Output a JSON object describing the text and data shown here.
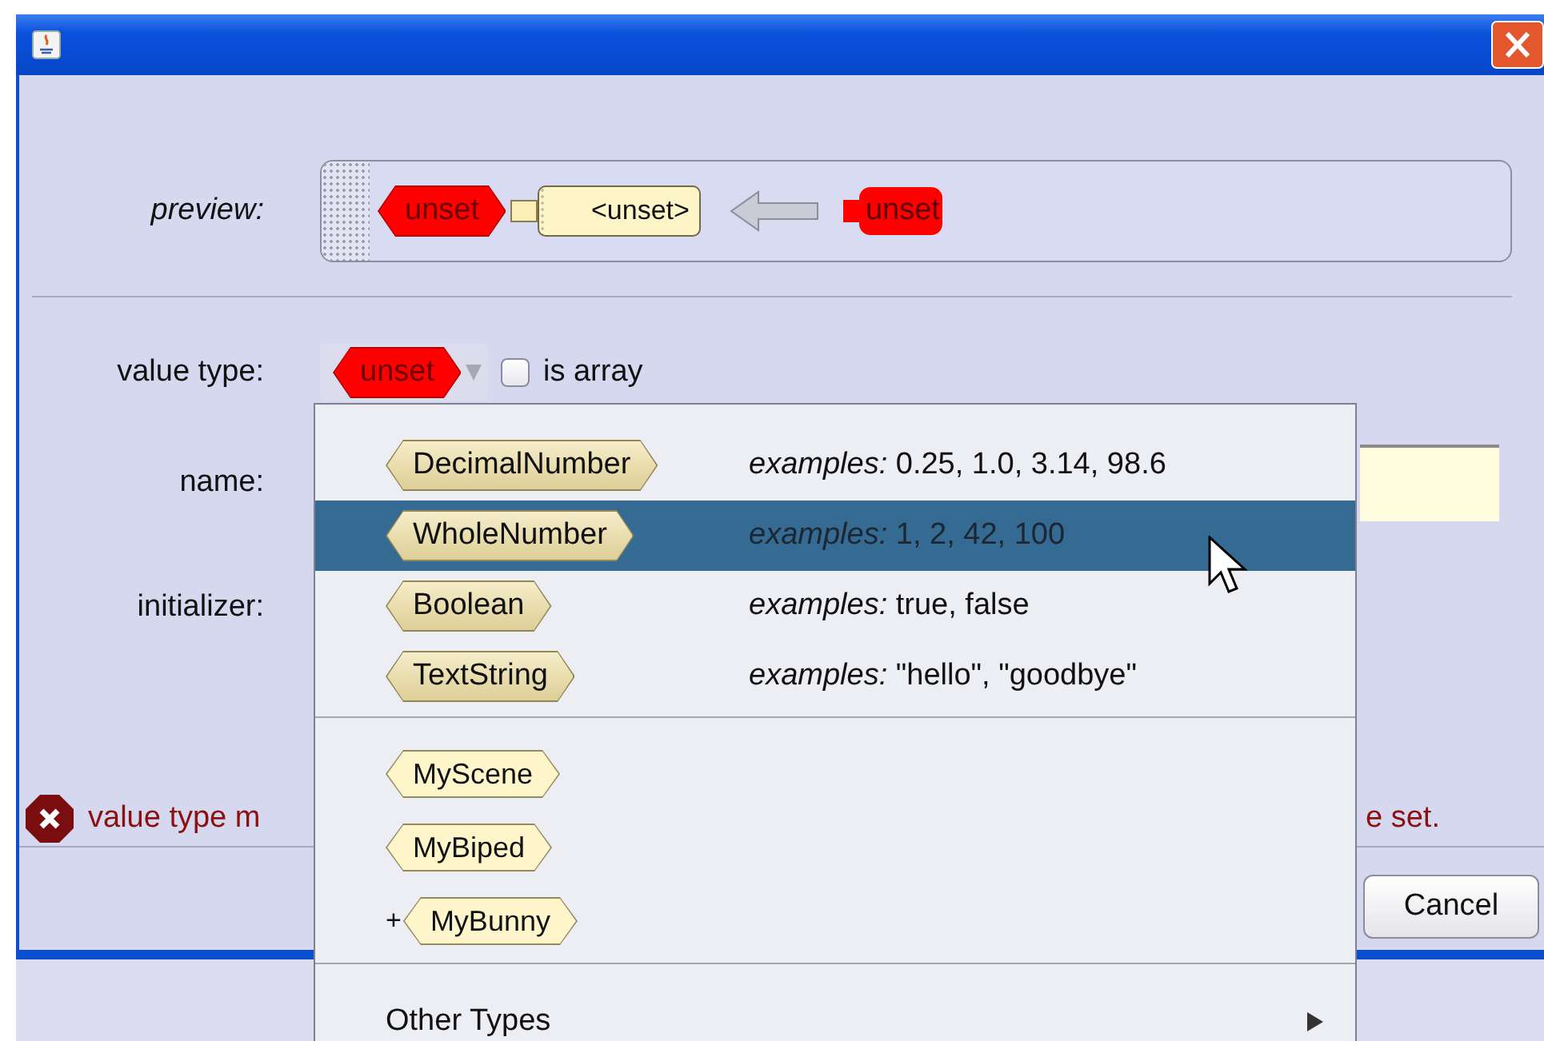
{
  "preview": {
    "label": "preview:",
    "parts": [
      {
        "kind": "type-tag",
        "text": "unset"
      },
      {
        "kind": "value-tag",
        "text": "<unset>"
      },
      {
        "kind": "arrow"
      },
      {
        "kind": "variable",
        "text": "unset"
      }
    ]
  },
  "form": {
    "value_type": {
      "label": "value type:",
      "value": "unset",
      "is_array": {
        "label": "is array",
        "checked": false
      }
    },
    "name": {
      "label": "name:"
    },
    "initializer": {
      "label": "initializer:"
    }
  },
  "error": {
    "text_start": "value type m",
    "text_end": "e set."
  },
  "buttons": [
    {
      "label": "Cancel"
    }
  ],
  "menu": {
    "items": [
      {
        "kind": "builtin",
        "tag": "DecimalNumber",
        "examples": "*examples:* 0.25, 1.0, 3.14, 98.6",
        "selected": false
      },
      {
        "kind": "builtin",
        "tag": "WholeNumber",
        "examples": "*examples:* 1, 2, 42, 100",
        "selected": true
      },
      {
        "kind": "builtin",
        "tag": "Boolean",
        "examples": "*examples:* true, false",
        "selected": false
      },
      {
        "kind": "builtin",
        "tag": "TextString",
        "examples": "*examples:* \"hello\", \"goodbye\"",
        "selected": false
      },
      {
        "kind": "separator"
      },
      {
        "kind": "user",
        "tag": "MyScene",
        "selected": false
      },
      {
        "kind": "user",
        "tag": "MyBiped",
        "selected": false
      },
      {
        "kind": "user",
        "tag": "MyBunny",
        "prefix": "+",
        "selected": false
      },
      {
        "kind": "separator"
      },
      {
        "kind": "submenu",
        "label": "Other Types",
        "selected": false
      }
    ]
  }
}
